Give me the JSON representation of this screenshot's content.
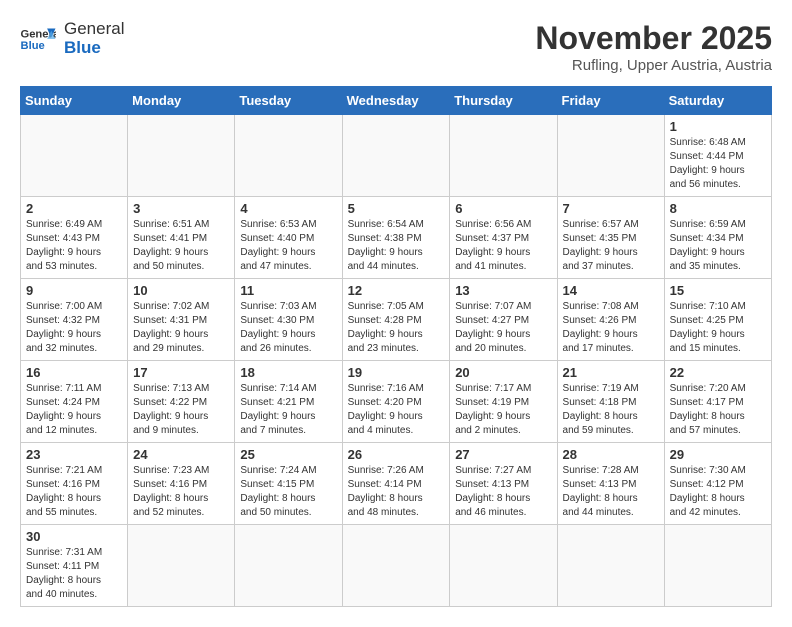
{
  "header": {
    "logo_general": "General",
    "logo_blue": "Blue",
    "month_title": "November 2025",
    "location": "Rufling, Upper Austria, Austria"
  },
  "days_of_week": [
    "Sunday",
    "Monday",
    "Tuesday",
    "Wednesday",
    "Thursday",
    "Friday",
    "Saturday"
  ],
  "weeks": [
    [
      {
        "day": "",
        "info": ""
      },
      {
        "day": "",
        "info": ""
      },
      {
        "day": "",
        "info": ""
      },
      {
        "day": "",
        "info": ""
      },
      {
        "day": "",
        "info": ""
      },
      {
        "day": "",
        "info": ""
      },
      {
        "day": "1",
        "info": "Sunrise: 6:48 AM\nSunset: 4:44 PM\nDaylight: 9 hours\nand 56 minutes."
      }
    ],
    [
      {
        "day": "2",
        "info": "Sunrise: 6:49 AM\nSunset: 4:43 PM\nDaylight: 9 hours\nand 53 minutes."
      },
      {
        "day": "3",
        "info": "Sunrise: 6:51 AM\nSunset: 4:41 PM\nDaylight: 9 hours\nand 50 minutes."
      },
      {
        "day": "4",
        "info": "Sunrise: 6:53 AM\nSunset: 4:40 PM\nDaylight: 9 hours\nand 47 minutes."
      },
      {
        "day": "5",
        "info": "Sunrise: 6:54 AM\nSunset: 4:38 PM\nDaylight: 9 hours\nand 44 minutes."
      },
      {
        "day": "6",
        "info": "Sunrise: 6:56 AM\nSunset: 4:37 PM\nDaylight: 9 hours\nand 41 minutes."
      },
      {
        "day": "7",
        "info": "Sunrise: 6:57 AM\nSunset: 4:35 PM\nDaylight: 9 hours\nand 37 minutes."
      },
      {
        "day": "8",
        "info": "Sunrise: 6:59 AM\nSunset: 4:34 PM\nDaylight: 9 hours\nand 35 minutes."
      }
    ],
    [
      {
        "day": "9",
        "info": "Sunrise: 7:00 AM\nSunset: 4:32 PM\nDaylight: 9 hours\nand 32 minutes."
      },
      {
        "day": "10",
        "info": "Sunrise: 7:02 AM\nSunset: 4:31 PM\nDaylight: 9 hours\nand 29 minutes."
      },
      {
        "day": "11",
        "info": "Sunrise: 7:03 AM\nSunset: 4:30 PM\nDaylight: 9 hours\nand 26 minutes."
      },
      {
        "day": "12",
        "info": "Sunrise: 7:05 AM\nSunset: 4:28 PM\nDaylight: 9 hours\nand 23 minutes."
      },
      {
        "day": "13",
        "info": "Sunrise: 7:07 AM\nSunset: 4:27 PM\nDaylight: 9 hours\nand 20 minutes."
      },
      {
        "day": "14",
        "info": "Sunrise: 7:08 AM\nSunset: 4:26 PM\nDaylight: 9 hours\nand 17 minutes."
      },
      {
        "day": "15",
        "info": "Sunrise: 7:10 AM\nSunset: 4:25 PM\nDaylight: 9 hours\nand 15 minutes."
      }
    ],
    [
      {
        "day": "16",
        "info": "Sunrise: 7:11 AM\nSunset: 4:24 PM\nDaylight: 9 hours\nand 12 minutes."
      },
      {
        "day": "17",
        "info": "Sunrise: 7:13 AM\nSunset: 4:22 PM\nDaylight: 9 hours\nand 9 minutes."
      },
      {
        "day": "18",
        "info": "Sunrise: 7:14 AM\nSunset: 4:21 PM\nDaylight: 9 hours\nand 7 minutes."
      },
      {
        "day": "19",
        "info": "Sunrise: 7:16 AM\nSunset: 4:20 PM\nDaylight: 9 hours\nand 4 minutes."
      },
      {
        "day": "20",
        "info": "Sunrise: 7:17 AM\nSunset: 4:19 PM\nDaylight: 9 hours\nand 2 minutes."
      },
      {
        "day": "21",
        "info": "Sunrise: 7:19 AM\nSunset: 4:18 PM\nDaylight: 8 hours\nand 59 minutes."
      },
      {
        "day": "22",
        "info": "Sunrise: 7:20 AM\nSunset: 4:17 PM\nDaylight: 8 hours\nand 57 minutes."
      }
    ],
    [
      {
        "day": "23",
        "info": "Sunrise: 7:21 AM\nSunset: 4:16 PM\nDaylight: 8 hours\nand 55 minutes."
      },
      {
        "day": "24",
        "info": "Sunrise: 7:23 AM\nSunset: 4:16 PM\nDaylight: 8 hours\nand 52 minutes."
      },
      {
        "day": "25",
        "info": "Sunrise: 7:24 AM\nSunset: 4:15 PM\nDaylight: 8 hours\nand 50 minutes."
      },
      {
        "day": "26",
        "info": "Sunrise: 7:26 AM\nSunset: 4:14 PM\nDaylight: 8 hours\nand 48 minutes."
      },
      {
        "day": "27",
        "info": "Sunrise: 7:27 AM\nSunset: 4:13 PM\nDaylight: 8 hours\nand 46 minutes."
      },
      {
        "day": "28",
        "info": "Sunrise: 7:28 AM\nSunset: 4:13 PM\nDaylight: 8 hours\nand 44 minutes."
      },
      {
        "day": "29",
        "info": "Sunrise: 7:30 AM\nSunset: 4:12 PM\nDaylight: 8 hours\nand 42 minutes."
      }
    ],
    [
      {
        "day": "30",
        "info": "Sunrise: 7:31 AM\nSunset: 4:11 PM\nDaylight: 8 hours\nand 40 minutes."
      },
      {
        "day": "",
        "info": ""
      },
      {
        "day": "",
        "info": ""
      },
      {
        "day": "",
        "info": ""
      },
      {
        "day": "",
        "info": ""
      },
      {
        "day": "",
        "info": ""
      },
      {
        "day": "",
        "info": ""
      }
    ]
  ]
}
